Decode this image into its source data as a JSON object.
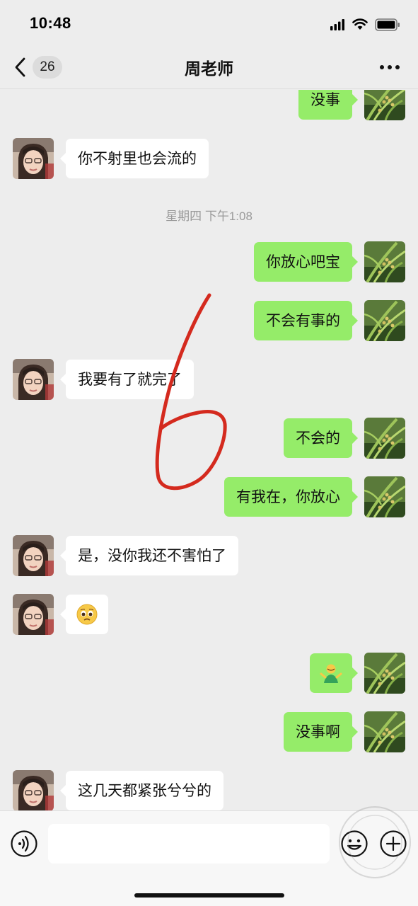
{
  "status_bar": {
    "time": "10:48"
  },
  "nav": {
    "badge": "26",
    "title": "周老师"
  },
  "timestamp": "星期四 下午1:08",
  "messages": {
    "m0": "没事",
    "m1": "你不射里也会流的",
    "m2": "你放心吧宝",
    "m3": "不会有事的",
    "m4": "我要有了就完了",
    "m5": "不会的",
    "m6": "有我在，你放心",
    "m7": "是，没你我还不害怕了",
    "m8": "🥺",
    "m9": "🤷",
    "m10": "没事啊",
    "m11": "这几天都紧张兮兮的"
  },
  "annotation_text": "6",
  "input": {
    "placeholder": ""
  },
  "colors": {
    "background": "#ededed",
    "outgoing_bubble": "#95ec69",
    "incoming_bubble": "#ffffff",
    "annotation_red": "#d42a1e"
  },
  "icons": [
    "signal-icon",
    "wifi-icon",
    "battery-icon",
    "back-chevron-icon",
    "more-icon",
    "voice-icon",
    "emoji-icon",
    "plus-icon"
  ]
}
